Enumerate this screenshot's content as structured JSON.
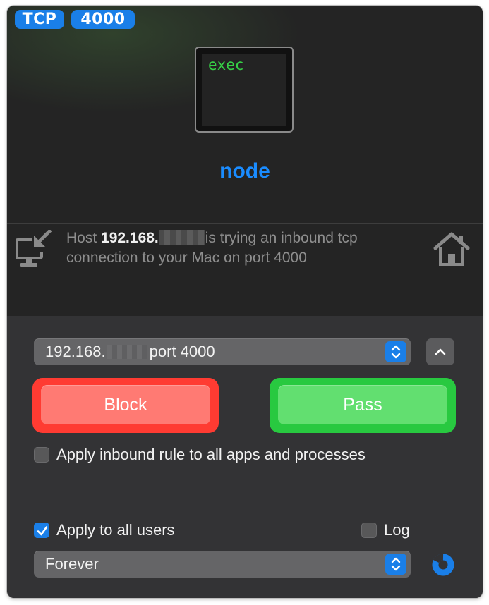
{
  "badges": {
    "protocol": "TCP",
    "port": "4000"
  },
  "process": {
    "icon_text": "exec",
    "name": "node"
  },
  "message": {
    "prefix": "Host ",
    "host_visible": "192.168.",
    "suffix": "is trying an inbound tcp connection to your Mac on port 4000"
  },
  "address_popup": {
    "ip_visible": "192.168.",
    "port_text": "port 4000"
  },
  "buttons": {
    "block": "Block",
    "pass": "Pass"
  },
  "options": {
    "apply_all_apps": {
      "label": "Apply inbound rule to all apps and processes",
      "checked": false
    },
    "apply_all_users": {
      "label": "Apply to all users",
      "checked": true
    },
    "log": {
      "label": "Log",
      "checked": false
    }
  },
  "duration": {
    "selected": "Forever"
  },
  "colors": {
    "accent": "#1a7fe8",
    "block": "#ff3b32",
    "pass": "#28c940",
    "exec_text": "#36d146"
  },
  "icons": [
    "inbound-connection-icon",
    "home-icon",
    "chevron-up-icon",
    "stepper-icon",
    "checkmark-icon",
    "progress-spinner-icon"
  ]
}
